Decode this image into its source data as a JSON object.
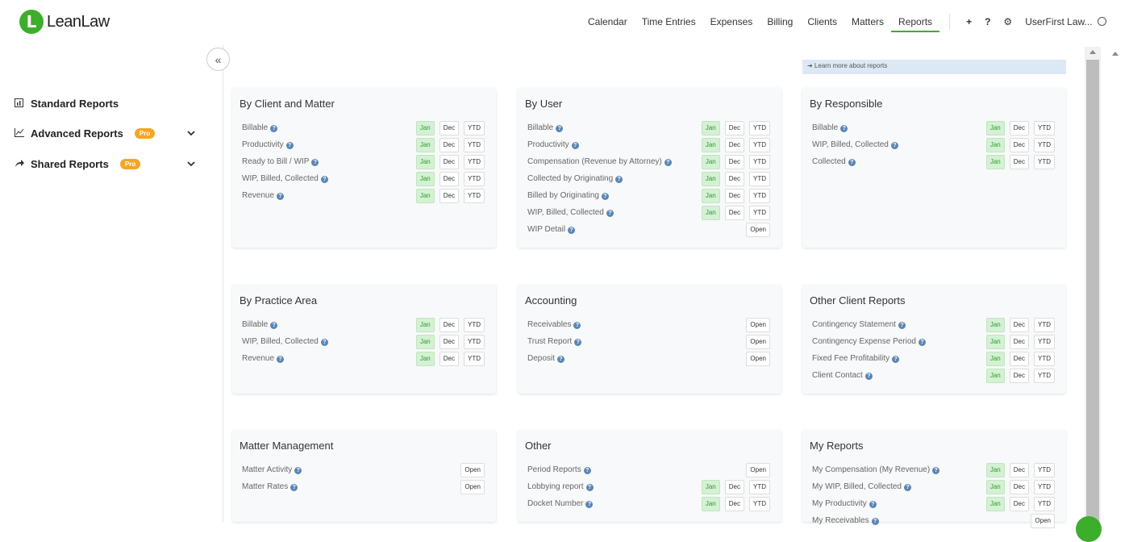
{
  "brand": {
    "logo_letter": "L",
    "name": "LeanLaw"
  },
  "nav": {
    "items": [
      "Calendar",
      "Time Entries",
      "Expenses",
      "Billing",
      "Clients",
      "Matters",
      "Reports"
    ],
    "active": "Reports",
    "plus": "+",
    "help": "?",
    "settings": "⚙",
    "user": "UserFirst Law..."
  },
  "sidebar": {
    "collapse": "«",
    "items": [
      {
        "label": "Standard Reports",
        "icon": "bar-chart-icon"
      },
      {
        "label": "Advanced Reports",
        "icon": "line-chart-icon",
        "badge": "Pro"
      },
      {
        "label": "Shared Reports",
        "icon": "share-icon",
        "badge": "Pro"
      }
    ]
  },
  "learn_more": "➔ Learn more about reports",
  "buttons": {
    "jan": "Jan",
    "dec": "Dec",
    "ytd": "YTD",
    "open": "Open"
  },
  "cards": [
    {
      "title": "By Client and Matter",
      "rows": [
        {
          "label": "Billable",
          "type": "period"
        },
        {
          "label": "Productivity",
          "type": "period"
        },
        {
          "label": "Ready to Bill / WIP",
          "type": "period"
        },
        {
          "label": "WIP, Billed, Collected",
          "type": "period"
        },
        {
          "label": "Revenue",
          "type": "period"
        }
      ]
    },
    {
      "title": "By User",
      "rows": [
        {
          "label": "Billable",
          "type": "period"
        },
        {
          "label": "Productivity",
          "type": "period"
        },
        {
          "label": "Compensation (Revenue by Attorney)",
          "type": "period"
        },
        {
          "label": "Collected by Originating",
          "type": "period"
        },
        {
          "label": "Billed by Originating",
          "type": "period"
        },
        {
          "label": "WIP, Billed, Collected",
          "type": "period"
        },
        {
          "label": "WIP Detail",
          "type": "open"
        }
      ]
    },
    {
      "title": "By Responsible",
      "rows": [
        {
          "label": "Billable",
          "type": "period"
        },
        {
          "label": "WIP, Billed, Collected",
          "type": "period"
        },
        {
          "label": "Collected",
          "type": "period"
        }
      ]
    },
    {
      "title": "By Practice Area",
      "rows": [
        {
          "label": "Billable",
          "type": "period"
        },
        {
          "label": "WIP, Billed, Collected",
          "type": "period"
        },
        {
          "label": "Revenue",
          "type": "period"
        }
      ]
    },
    {
      "title": "Accounting",
      "rows": [
        {
          "label": "Receivables",
          "type": "open"
        },
        {
          "label": "Trust Report",
          "type": "open"
        },
        {
          "label": "Deposit",
          "type": "open"
        }
      ]
    },
    {
      "title": "Other Client Reports",
      "rows": [
        {
          "label": "Contingency Statement",
          "type": "period"
        },
        {
          "label": "Contingency Expense Period",
          "type": "period"
        },
        {
          "label": "Fixed Fee Profitability",
          "type": "period"
        },
        {
          "label": "Client Contact",
          "type": "period"
        }
      ]
    },
    {
      "title": "Matter Management",
      "rows": [
        {
          "label": "Matter Activity",
          "type": "open"
        },
        {
          "label": "Matter Rates",
          "type": "open"
        }
      ]
    },
    {
      "title": "Other",
      "rows": [
        {
          "label": "Period Reports",
          "type": "open"
        },
        {
          "label": "Lobbying report",
          "type": "period"
        },
        {
          "label": "Docket Number",
          "type": "period"
        }
      ]
    },
    {
      "title": "My Reports",
      "rows": [
        {
          "label": "My Compensation (My Revenue)",
          "type": "period"
        },
        {
          "label": "My WIP, Billed, Collected",
          "type": "period"
        },
        {
          "label": "My Productivity",
          "type": "period"
        },
        {
          "label": "My Receivables",
          "type": "open"
        }
      ]
    }
  ]
}
